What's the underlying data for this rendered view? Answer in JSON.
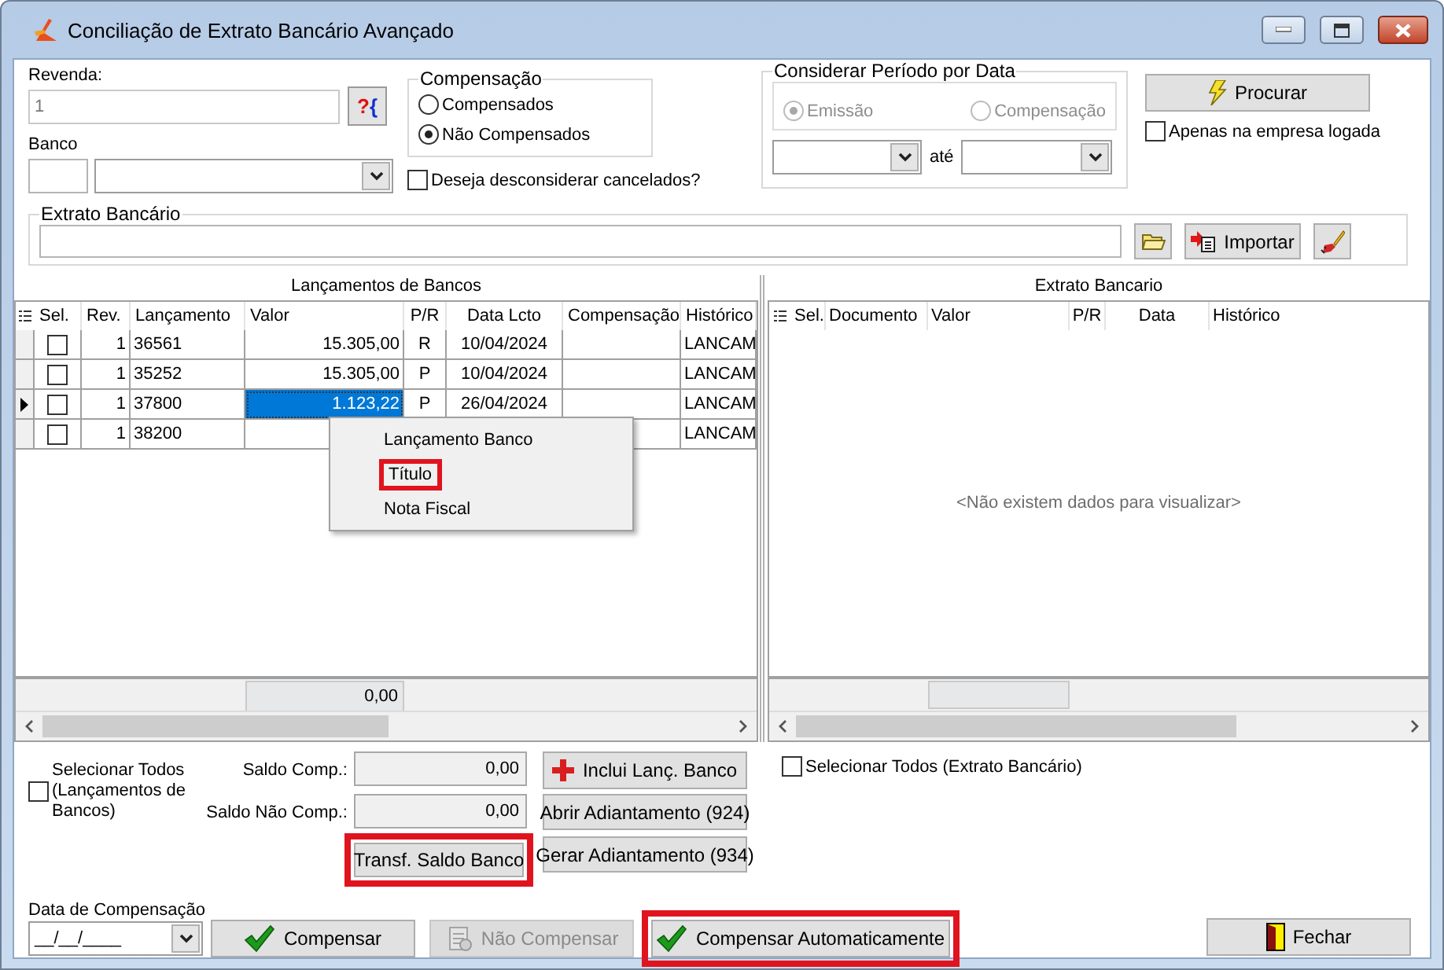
{
  "window": {
    "title": "Conciliação de Extrato Bancário Avançado"
  },
  "revenda": {
    "label": "Revenda:",
    "value": "1",
    "lookup_symbols": [
      "?",
      "{"
    ]
  },
  "banco": {
    "label": "Banco"
  },
  "compensacao": {
    "title": "Compensação",
    "options": [
      {
        "label": "Compensados",
        "selected": false
      },
      {
        "label": "Não Compensados",
        "selected": true
      }
    ]
  },
  "desconsiderar_cancelados": {
    "label": "Deseja desconsiderar cancelados?",
    "checked": false
  },
  "periodo": {
    "title": "Considerar Período por Data",
    "options": [
      {
        "label": "Emissão",
        "selected": true,
        "disabled": true
      },
      {
        "label": "Compensação",
        "selected": false,
        "disabled": true
      }
    ],
    "separator": "até"
  },
  "procurar_button": {
    "label": "Procurar"
  },
  "apenas_empresa": {
    "label": "Apenas na empresa logada",
    "checked": false
  },
  "extrato": {
    "title": "Extrato Bancário",
    "import_label": "Importar"
  },
  "lancamentos": {
    "title": "Lançamentos de Bancos",
    "columns": [
      "Sel.",
      "Rev.",
      "Lançamento",
      "Valor",
      "P/R",
      "Data Lcto",
      "Compensação",
      "Histórico"
    ],
    "rows": [
      {
        "current": false,
        "checked": false,
        "valor_selected": false,
        "rev": "1",
        "lancamento": "36561",
        "valor": "15.305,00",
        "pr": "R",
        "data": "10/04/2024",
        "historico": "LANCAM"
      },
      {
        "current": false,
        "checked": false,
        "valor_selected": false,
        "rev": "1",
        "lancamento": "35252",
        "valor": "15.305,00",
        "pr": "P",
        "data": "10/04/2024",
        "historico": "LANCAM"
      },
      {
        "current": true,
        "checked": false,
        "valor_selected": true,
        "rev": "1",
        "lancamento": "37800",
        "valor": "1.123,22",
        "pr": "P",
        "data": "26/04/2024",
        "historico": "LANCAM"
      },
      {
        "current": false,
        "checked": false,
        "valor_selected": false,
        "rev": "1",
        "lancamento": "38200",
        "historico": "LANCAM"
      }
    ],
    "total": "0,00"
  },
  "context_menu": [
    {
      "label": "Lançamento Banco",
      "highlighted": false
    },
    {
      "label": "Título",
      "highlighted": true
    },
    {
      "label": "Nota Fiscal",
      "highlighted": false
    }
  ],
  "extrato_grid": {
    "title": "Extrato Bancario",
    "columns": [
      "Sel.",
      "Documento",
      "Valor",
      "P/R",
      "Data",
      "Histórico"
    ],
    "empty_message": "<Não existem dados para visualizar>"
  },
  "selecionar_todos_lancamentos": {
    "label": "Selecionar Todos (Lançamentos de Bancos)",
    "checked": false
  },
  "saldo_comp": {
    "label": "Saldo Comp.:",
    "value": "0,00"
  },
  "saldo_nao_comp": {
    "label": "Saldo Não Comp.:",
    "value": "0,00"
  },
  "side_buttons": [
    {
      "label": "Inclui Lanç. Banco",
      "kind": "add"
    },
    {
      "label": "Abrir Adiantamento (924)",
      "kind": "plain"
    },
    {
      "label": "Gerar Adiantamento (934)",
      "kind": "plain"
    }
  ],
  "transf_button": {
    "label": "Transf. Saldo Banco",
    "highlighted": true
  },
  "selecionar_todos_extrato": {
    "label": "Selecionar Todos (Extrato Bancário)",
    "checked": false
  },
  "data_compensacao": {
    "label": "Data de Compensação",
    "value": "__/__/____"
  },
  "actions": [
    {
      "label": "Compensar",
      "kind": "check",
      "disabled": false,
      "highlighted": false
    },
    {
      "label": "Não Compensar",
      "kind": "undo",
      "disabled": true,
      "highlighted": false
    },
    {
      "label": "Compensar Automaticamente",
      "kind": "check",
      "disabled": false,
      "highlighted": true
    }
  ],
  "fechar_button": {
    "label": "Fechar"
  }
}
